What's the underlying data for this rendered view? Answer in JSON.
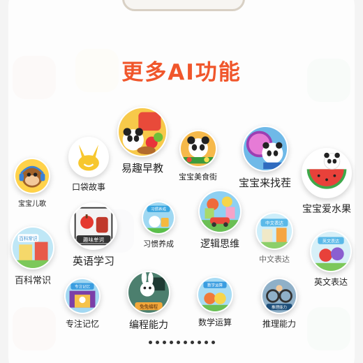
{
  "title": "更多AI功能",
  "apps": [
    {
      "id": "yiqu-zaojiao",
      "label": "易趣早教",
      "icon": "panda-fruit-basket-icon"
    },
    {
      "id": "baobao-meishijie",
      "label": "宝宝美食街",
      "icon": "panda-chef-icon"
    },
    {
      "id": "baobao-laizhaocha",
      "label": "宝宝来找茬",
      "icon": "panda-magnifier-icon"
    },
    {
      "id": "koudai-gushi",
      "label": "口袋故事",
      "icon": "yellow-bunny-icon"
    },
    {
      "id": "baobao-erge",
      "label": "宝宝儿歌",
      "icon": "monkey-headphones-icon"
    },
    {
      "id": "baobao-aishuiguo",
      "label": "宝宝爱水果",
      "icon": "panda-watermelon-icon"
    },
    {
      "id": "yingyu-xuexi",
      "label": "英语学习",
      "icon": "apple-words-icon",
      "badge": "趣味单词"
    },
    {
      "id": "xiguan-yangcheng",
      "label": "习惯养成",
      "icon": "habit-cartoon-icon",
      "badge": "习惯养成"
    },
    {
      "id": "luoji-siwei",
      "label": "逻辑思维",
      "icon": "car-town-icon"
    },
    {
      "id": "zhongwen-biaoda",
      "label": "中文表达",
      "icon": "chinese-expression-icon",
      "badge": "中文表达"
    },
    {
      "id": "baike-changshi",
      "label": "百科常识",
      "icon": "encyclopedia-icon",
      "badge": "百科常识"
    },
    {
      "id": "yingwen-biaoda",
      "label": "英文表达",
      "icon": "english-expression-icon",
      "badge": "英文表达"
    },
    {
      "id": "zhuanzhu-jiyi",
      "label": "专注记忆",
      "icon": "memory-stage-icon",
      "badge": "专注记忆"
    },
    {
      "id": "biancheng-nengli",
      "label": "编程能力",
      "icon": "rabbit-teacher-icon",
      "badge": "兔兔编程"
    },
    {
      "id": "shuxue-yunsuan",
      "label": "数学运算",
      "icon": "math-cartoon-icon",
      "badge": "数学运算"
    },
    {
      "id": "tuili-nengli",
      "label": "推理能力",
      "icon": "bike-reasoning-icon",
      "badge": "推理能力"
    }
  ],
  "pagination": {
    "count": 10,
    "active": 0
  },
  "colors": {
    "title": "#f0562b"
  }
}
